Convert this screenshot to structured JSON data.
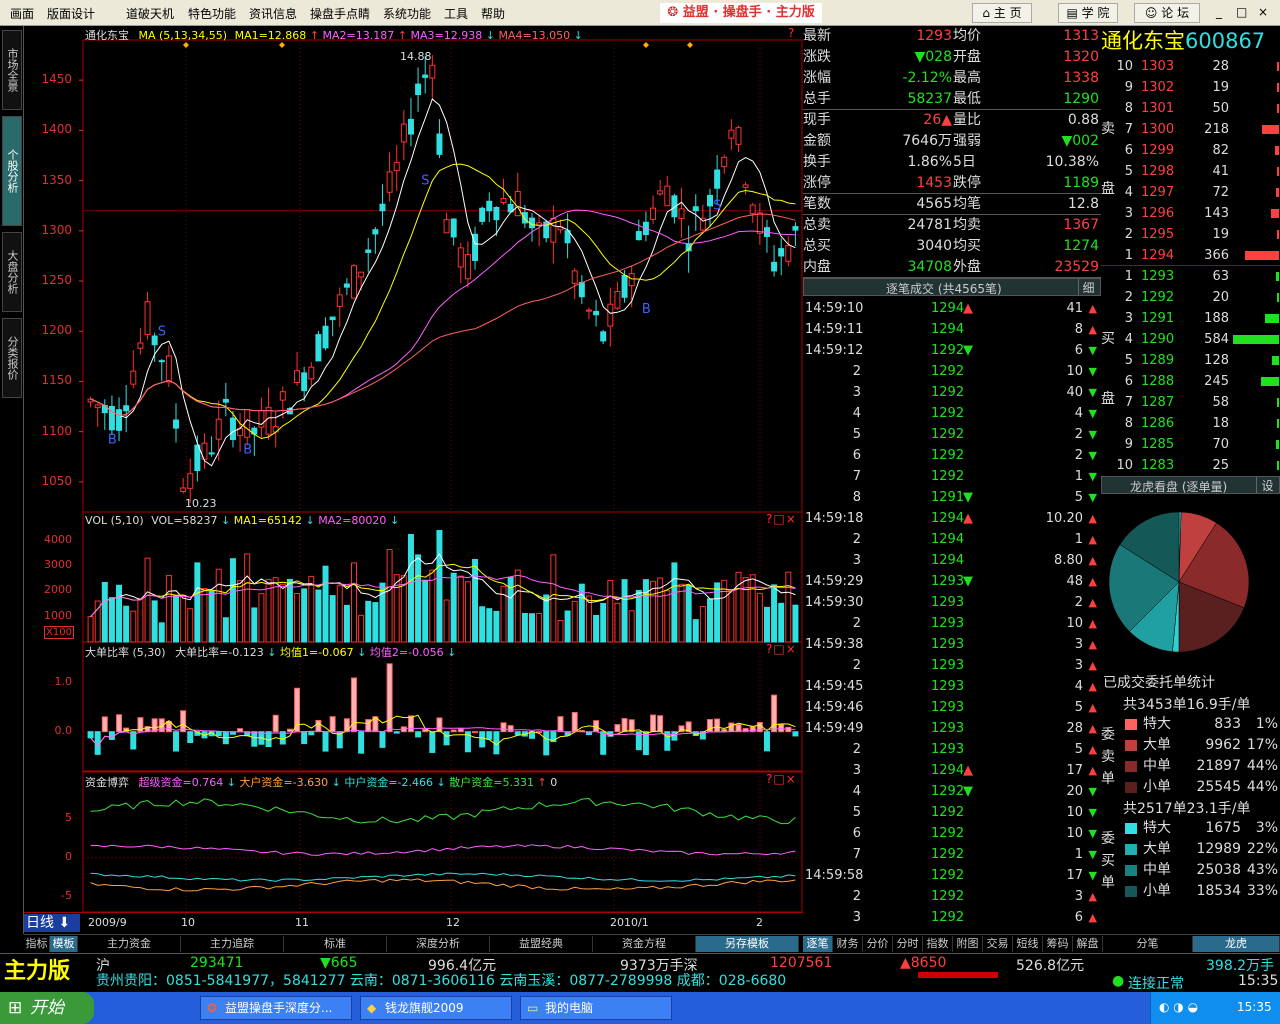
{
  "menu": {
    "items": [
      "画面",
      "版面设计",
      "道破天机",
      "特色功能",
      "资讯信息",
      "操盘手点睛",
      "系统功能",
      "工具",
      "帮助"
    ],
    "brand": "益盟 · 操盘手 · 主力版",
    "nav": [
      "主 页",
      "学 院",
      "论 坛"
    ],
    "win_controls": [
      "_",
      "□",
      "×"
    ]
  },
  "left_tabs": [
    "市场全景",
    "个股分析",
    "大盘分析",
    "分类报价"
  ],
  "price_panel": {
    "header": {
      "name": "通化东宝",
      "ma": "MA (5,13,34,55)",
      "ma1": "MA1=12.868",
      "ma2": "MA2=13.187",
      "ma3": "MA3=12.938",
      "ma4": "MA4=13.050"
    },
    "high_label": "14.88",
    "low_label": "10.23",
    "markers": {
      "buy": "B",
      "sell": "S"
    },
    "help_icon": "?"
  },
  "vol_panel": {
    "header": {
      "name": "VOL (5,10)",
      "vol": "VOL=58237",
      "ma1": "MA1=65142",
      "ma2": "MA2=80020"
    },
    "unit": "X100",
    "help_icons": [
      "?",
      "□",
      "×"
    ]
  },
  "ratio_panel": {
    "header": {
      "name": "大单比率",
      "params": "(5,30)",
      "v": "大单比率=-0.123",
      "a1": "均值1=-0.067",
      "a2": "均值2=-0.056"
    },
    "help_icons": [
      "?",
      "□",
      "×"
    ]
  },
  "fund_panel": {
    "header": {
      "name": "资金博弈",
      "s1": "超级资金=0.764",
      "s2": "大户资金=-3.630",
      "s3": "中户资金=-2.466",
      "s4": "散户资金=5.331",
      "s5": "0"
    },
    "help_icons": [
      "?",
      "□",
      "×"
    ]
  },
  "x_axis": {
    "labels": [
      "2009/9",
      "10",
      "11",
      "12",
      "2010/1",
      "2"
    ],
    "period": "日线"
  },
  "bottom_tabs": [
    "指标",
    "模板",
    "主力资金",
    "主力追踪",
    "标准",
    "深度分析",
    "益盟经典",
    "资金方程",
    "另存模板"
  ],
  "chart_data": [
    {
      "type": "candlestick",
      "title": "通化东宝",
      "ylim": [
        1020,
        1490
      ],
      "y_ticks": [
        1050,
        1100,
        1150,
        1200,
        1250,
        1300,
        1350,
        1400,
        1450
      ],
      "ma_labels": [
        "MA1=12.868",
        "MA2=13.187",
        "MA3=12.938",
        "MA4=13.050"
      ],
      "high": 1488,
      "low": 1023
    },
    {
      "type": "bar",
      "title": "VOL (5,10)",
      "ylim": [
        0,
        4500
      ],
      "y_ticks": [
        1000,
        2000,
        3000,
        4000
      ]
    },
    {
      "type": "bar",
      "title": "大单比率",
      "ylim": [
        -0.8,
        1.5
      ],
      "y_ticks": [
        0.0,
        1.0
      ]
    },
    {
      "type": "line",
      "title": "资金博弈",
      "ylim": [
        -7,
        9
      ],
      "y_ticks": [
        -5,
        0,
        5
      ],
      "series": [
        {
          "name": "超级资金"
        },
        {
          "name": "大户资金"
        },
        {
          "name": "中户资金"
        },
        {
          "name": "散户资金"
        }
      ]
    }
  ],
  "quote": {
    "rows": [
      {
        "k1": "最新",
        "v1": "1293",
        "c1": "red",
        "k2": "均价",
        "v2": "1313",
        "c2": "red"
      },
      {
        "k1": "涨跌",
        "v1": "▼028",
        "c1": "grn",
        "k2": "开盘",
        "v2": "1320",
        "c2": "red"
      },
      {
        "k1": "涨幅",
        "v1": "-2.12%",
        "c1": "grn",
        "k2": "最高",
        "v2": "1338",
        "c2": "red"
      },
      {
        "k1": "总手",
        "v1": "58237",
        "c1": "grn",
        "k2": "最低",
        "v2": "1290",
        "c2": "grn"
      },
      {
        "k1": "现手",
        "v1": "26▲",
        "c1": "red",
        "k2": "量比",
        "v2": "0.88",
        "c2": "wht"
      },
      {
        "k1": "金额",
        "v1": "7646万",
        "c1": "wht",
        "k2": "强弱",
        "v2": "▼002",
        "c2": "grn"
      },
      {
        "k1": "换手",
        "v1": "1.86%",
        "c1": "wht",
        "k2": "5日",
        "v2": "10.38%",
        "c2": "wht"
      },
      {
        "k1": "涨停",
        "v1": "1453",
        "c1": "red",
        "k2": "跌停",
        "v2": "1189",
        "c2": "grn"
      },
      {
        "k1": "笔数",
        "v1": "4565",
        "c1": "wht",
        "k2": "均笔",
        "v2": "12.8",
        "c2": "wht"
      },
      {
        "k1": "总卖",
        "v1": "24781",
        "c1": "wht",
        "k2": "均卖",
        "v2": "1367",
        "c2": "red"
      },
      {
        "k1": "总买",
        "v1": "3040",
        "c1": "wht",
        "k2": "均买",
        "v2": "1274",
        "c2": "grn"
      },
      {
        "k1": "内盘",
        "v1": "34708",
        "c1": "grn",
        "k2": "外盘",
        "v2": "23529",
        "c2": "red"
      }
    ]
  },
  "ticks": {
    "header": "逐笔成交 (共4565笔)",
    "detail_btn": "细",
    "rows": [
      {
        "t": "14:59:10",
        "p": "1294",
        "d": "▲",
        "v": "41",
        "vd": "▲"
      },
      {
        "t": "14:59:11",
        "p": "1294",
        "d": "",
        "v": "8",
        "vd": "▲"
      },
      {
        "t": "14:59:12",
        "p": "1292",
        "d": "▼",
        "v": "6",
        "vd": "▼"
      },
      {
        "t": "2",
        "p": "1292",
        "d": "",
        "v": "10",
        "vd": "▼"
      },
      {
        "t": "3",
        "p": "1292",
        "d": "",
        "v": "40",
        "vd": "▼"
      },
      {
        "t": "4",
        "p": "1292",
        "d": "",
        "v": "4",
        "vd": "▼"
      },
      {
        "t": "5",
        "p": "1292",
        "d": "",
        "v": "2",
        "vd": "▼"
      },
      {
        "t": "6",
        "p": "1292",
        "d": "",
        "v": "2",
        "vd": "▼"
      },
      {
        "t": "7",
        "p": "1292",
        "d": "",
        "v": "1",
        "vd": "▼"
      },
      {
        "t": "8",
        "p": "1291",
        "d": "▼",
        "v": "5",
        "vd": "▼"
      },
      {
        "t": "14:59:18",
        "p": "1294",
        "d": "▲",
        "v": "10.20",
        "vd": "▲"
      },
      {
        "t": "2",
        "p": "1294",
        "d": "",
        "v": "1",
        "vd": "▲"
      },
      {
        "t": "3",
        "p": "1294",
        "d": "",
        "v": "8.80",
        "vd": "▲"
      },
      {
        "t": "14:59:29",
        "p": "1293",
        "d": "▼",
        "v": "48",
        "vd": "▲"
      },
      {
        "t": "14:59:30",
        "p": "1293",
        "d": "",
        "v": "2",
        "vd": "▲"
      },
      {
        "t": "2",
        "p": "1293",
        "d": "",
        "v": "10",
        "vd": "▲"
      },
      {
        "t": "14:59:38",
        "p": "1293",
        "d": "",
        "v": "3",
        "vd": "▲"
      },
      {
        "t": "2",
        "p": "1293",
        "d": "",
        "v": "3",
        "vd": "▲"
      },
      {
        "t": "14:59:45",
        "p": "1293",
        "d": "",
        "v": "4",
        "vd": "▲"
      },
      {
        "t": "14:59:46",
        "p": "1293",
        "d": "",
        "v": "5",
        "vd": "▲"
      },
      {
        "t": "14:59:49",
        "p": "1293",
        "d": "",
        "v": "28",
        "vd": "▲"
      },
      {
        "t": "2",
        "p": "1293",
        "d": "",
        "v": "5",
        "vd": "▲"
      },
      {
        "t": "3",
        "p": "1294",
        "d": "▲",
        "v": "17",
        "vd": "▲"
      },
      {
        "t": "4",
        "p": "1292",
        "d": "▼",
        "v": "20",
        "vd": "▼"
      },
      {
        "t": "5",
        "p": "1292",
        "d": "",
        "v": "10",
        "vd": "▼"
      },
      {
        "t": "6",
        "p": "1292",
        "d": "",
        "v": "10",
        "vd": "▼"
      },
      {
        "t": "7",
        "p": "1292",
        "d": "",
        "v": "1",
        "vd": "▼"
      },
      {
        "t": "14:59:58",
        "p": "1292",
        "d": "",
        "v": "17",
        "vd": "▼"
      },
      {
        "t": "2",
        "p": "1292",
        "d": "",
        "v": "3",
        "vd": "▲"
      },
      {
        "t": "3",
        "p": "1292",
        "d": "",
        "v": "6",
        "vd": "▲"
      }
    ]
  },
  "stock_header": {
    "name": "通化东宝",
    "code": "600867"
  },
  "order_book": {
    "sell_label": [
      "卖",
      "盘"
    ],
    "buy_label": [
      "买",
      "盘"
    ],
    "sell": [
      {
        "lv": "10",
        "p": "1303",
        "v": "28",
        "bar": 0.02
      },
      {
        "lv": "9",
        "p": "1302",
        "v": "19",
        "bar": 0.02
      },
      {
        "lv": "8",
        "p": "1301",
        "v": "50",
        "bar": 0.04
      },
      {
        "lv": "7",
        "p": "1300",
        "v": "218",
        "bar": 0.37
      },
      {
        "lv": "6",
        "p": "1299",
        "v": "82",
        "bar": 0.08
      },
      {
        "lv": "5",
        "p": "1298",
        "v": "41",
        "bar": 0.04
      },
      {
        "lv": "4",
        "p": "1297",
        "v": "72",
        "bar": 0.06
      },
      {
        "lv": "3",
        "p": "1296",
        "v": "143",
        "bar": 0.18
      },
      {
        "lv": "2",
        "p": "1295",
        "v": "19",
        "bar": 0.02
      },
      {
        "lv": "1",
        "p": "1294",
        "v": "366",
        "bar": 0.75
      }
    ],
    "buy": [
      {
        "lv": "1",
        "p": "1293",
        "v": "63",
        "bar": 0.06
      },
      {
        "lv": "2",
        "p": "1292",
        "v": "20",
        "bar": 0.02
      },
      {
        "lv": "3",
        "p": "1291",
        "v": "188",
        "bar": 0.3
      },
      {
        "lv": "4",
        "p": "1290",
        "v": "584",
        "bar": 1.0
      },
      {
        "lv": "5",
        "p": "1289",
        "v": "128",
        "bar": 0.15
      },
      {
        "lv": "6",
        "p": "1288",
        "v": "245",
        "bar": 0.4
      },
      {
        "lv": "7",
        "p": "1287",
        "v": "58",
        "bar": 0.04
      },
      {
        "lv": "8",
        "p": "1286",
        "v": "18",
        "bar": 0.02
      },
      {
        "lv": "9",
        "p": "1285",
        "v": "70",
        "bar": 0.06
      },
      {
        "lv": "10",
        "p": "1283",
        "v": "25",
        "bar": 0.02
      }
    ]
  },
  "longhu": {
    "title": "龙虎看盘 (逐单量)",
    "btn": "设"
  },
  "pie": {
    "slices": [
      {
        "value": 1,
        "color": "#20c0c0"
      },
      {
        "value": 17,
        "color": "#c04040"
      },
      {
        "value": 44,
        "color": "#8a2a2a"
      },
      {
        "value": 38,
        "color": "#5a2020"
      },
      {
        "value": 3,
        "color": "#30d0d0"
      },
      {
        "value": 22,
        "color": "#20a0a0"
      },
      {
        "value": 43,
        "color": "#1a7878"
      },
      {
        "value": 32,
        "color": "#155858"
      }
    ]
  },
  "stats": {
    "title": "已成交委托单统计",
    "sell_total": "共3453单16.9手/单",
    "sell_side": [
      "委",
      "卖",
      "单"
    ],
    "sell_rows": [
      {
        "n": "特大",
        "v": "833",
        "p": "1%",
        "c": "#ff6060"
      },
      {
        "n": "大单",
        "v": "9962",
        "p": "17%",
        "c": "#c04040"
      },
      {
        "n": "中单",
        "v": "21897",
        "p": "44%",
        "c": "#8a2a2a"
      },
      {
        "n": "小单",
        "v": "25545",
        "p": "44%",
        "c": "#5a2020"
      }
    ],
    "buy_total": "共2517单23.1手/单",
    "buy_side": [
      "委",
      "买",
      "单"
    ],
    "buy_rows": [
      {
        "n": "特大",
        "v": "1675",
        "p": "3%",
        "c": "#30e0e0"
      },
      {
        "n": "大单",
        "v": "12989",
        "p": "22%",
        "c": "#20b0b0"
      },
      {
        "n": "中单",
        "v": "25038",
        "p": "43%",
        "c": "#1a8080"
      },
      {
        "n": "小单",
        "v": "18534",
        "p": "33%",
        "c": "#155858"
      }
    ]
  },
  "right_tabs": [
    "逐笔",
    "财务",
    "分价",
    "分时",
    "指数",
    "附图",
    "交易",
    "短线",
    "筹码",
    "解盘",
    "分笔",
    "龙虎"
  ],
  "status": {
    "logo": "主力版",
    "sh": "沪",
    "sh_idx": "293471",
    "sh_chg": "▼665",
    "sh_amt": "996.4亿元",
    "sz_amt": "9373万手深",
    "sz_idx": "1207561",
    "sz_chg": "▲8650",
    "sz_amt2": "526.8亿元",
    "sz_vol": "398.2万手",
    "ticker": "贵州贵阳：0851-5841977，5841277    云南：0871-3606116    云南玉溪：0877-2789998    成都：028-6680",
    "conn": "连接正常",
    "time": "15:35"
  },
  "taskbar": {
    "start": "开始",
    "buttons": [
      "益盟操盘手深度分...",
      "钱龙旗舰2009",
      "我的电脑"
    ],
    "clock": "15:35"
  }
}
